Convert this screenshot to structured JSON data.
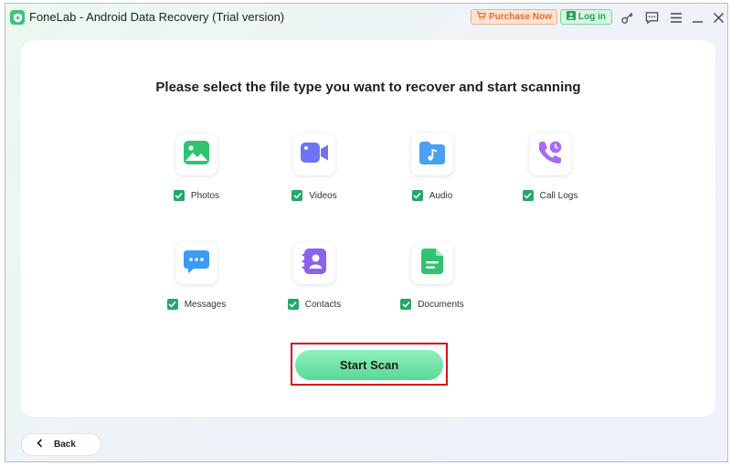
{
  "app": {
    "title": "FoneLab - Android Data Recovery (Trial version)",
    "logo_icon": "shield-plus-icon",
    "brand_color": "#3cc47a"
  },
  "titlebar": {
    "purchase_label": "Purchase Now",
    "purchase_icon": "cart-icon",
    "login_label": "Log in",
    "login_icon": "user-icon",
    "controls": [
      "key-icon",
      "feedback-icon",
      "menu-icon",
      "minimize-icon",
      "close-icon"
    ]
  },
  "main": {
    "heading": "Please select the file type you want to recover and start scanning",
    "file_types": [
      {
        "label": "Photos",
        "icon": "photos-icon",
        "checked": true,
        "color": "#2fc46f"
      },
      {
        "label": "Videos",
        "icon": "videos-icon",
        "checked": true,
        "color": "#6f74f3"
      },
      {
        "label": "Audio",
        "icon": "audio-icon",
        "checked": true,
        "color": "#4aa0f0"
      },
      {
        "label": "Call Logs",
        "icon": "call-logs-icon",
        "checked": true,
        "color": "#a86cf0"
      },
      {
        "label": "Messages",
        "icon": "messages-icon",
        "checked": true,
        "color": "#3a9cf2"
      },
      {
        "label": "Contacts",
        "icon": "contacts-icon",
        "checked": true,
        "color": "#8a62ee"
      },
      {
        "label": "Documents",
        "icon": "documents-icon",
        "checked": true,
        "color": "#2fc46f"
      }
    ],
    "scan_label": "Start Scan",
    "check_color": "#22a86a",
    "highlight_color": "#d01515"
  },
  "footer": {
    "back_label": "Back",
    "back_icon": "chevron-left-icon"
  }
}
